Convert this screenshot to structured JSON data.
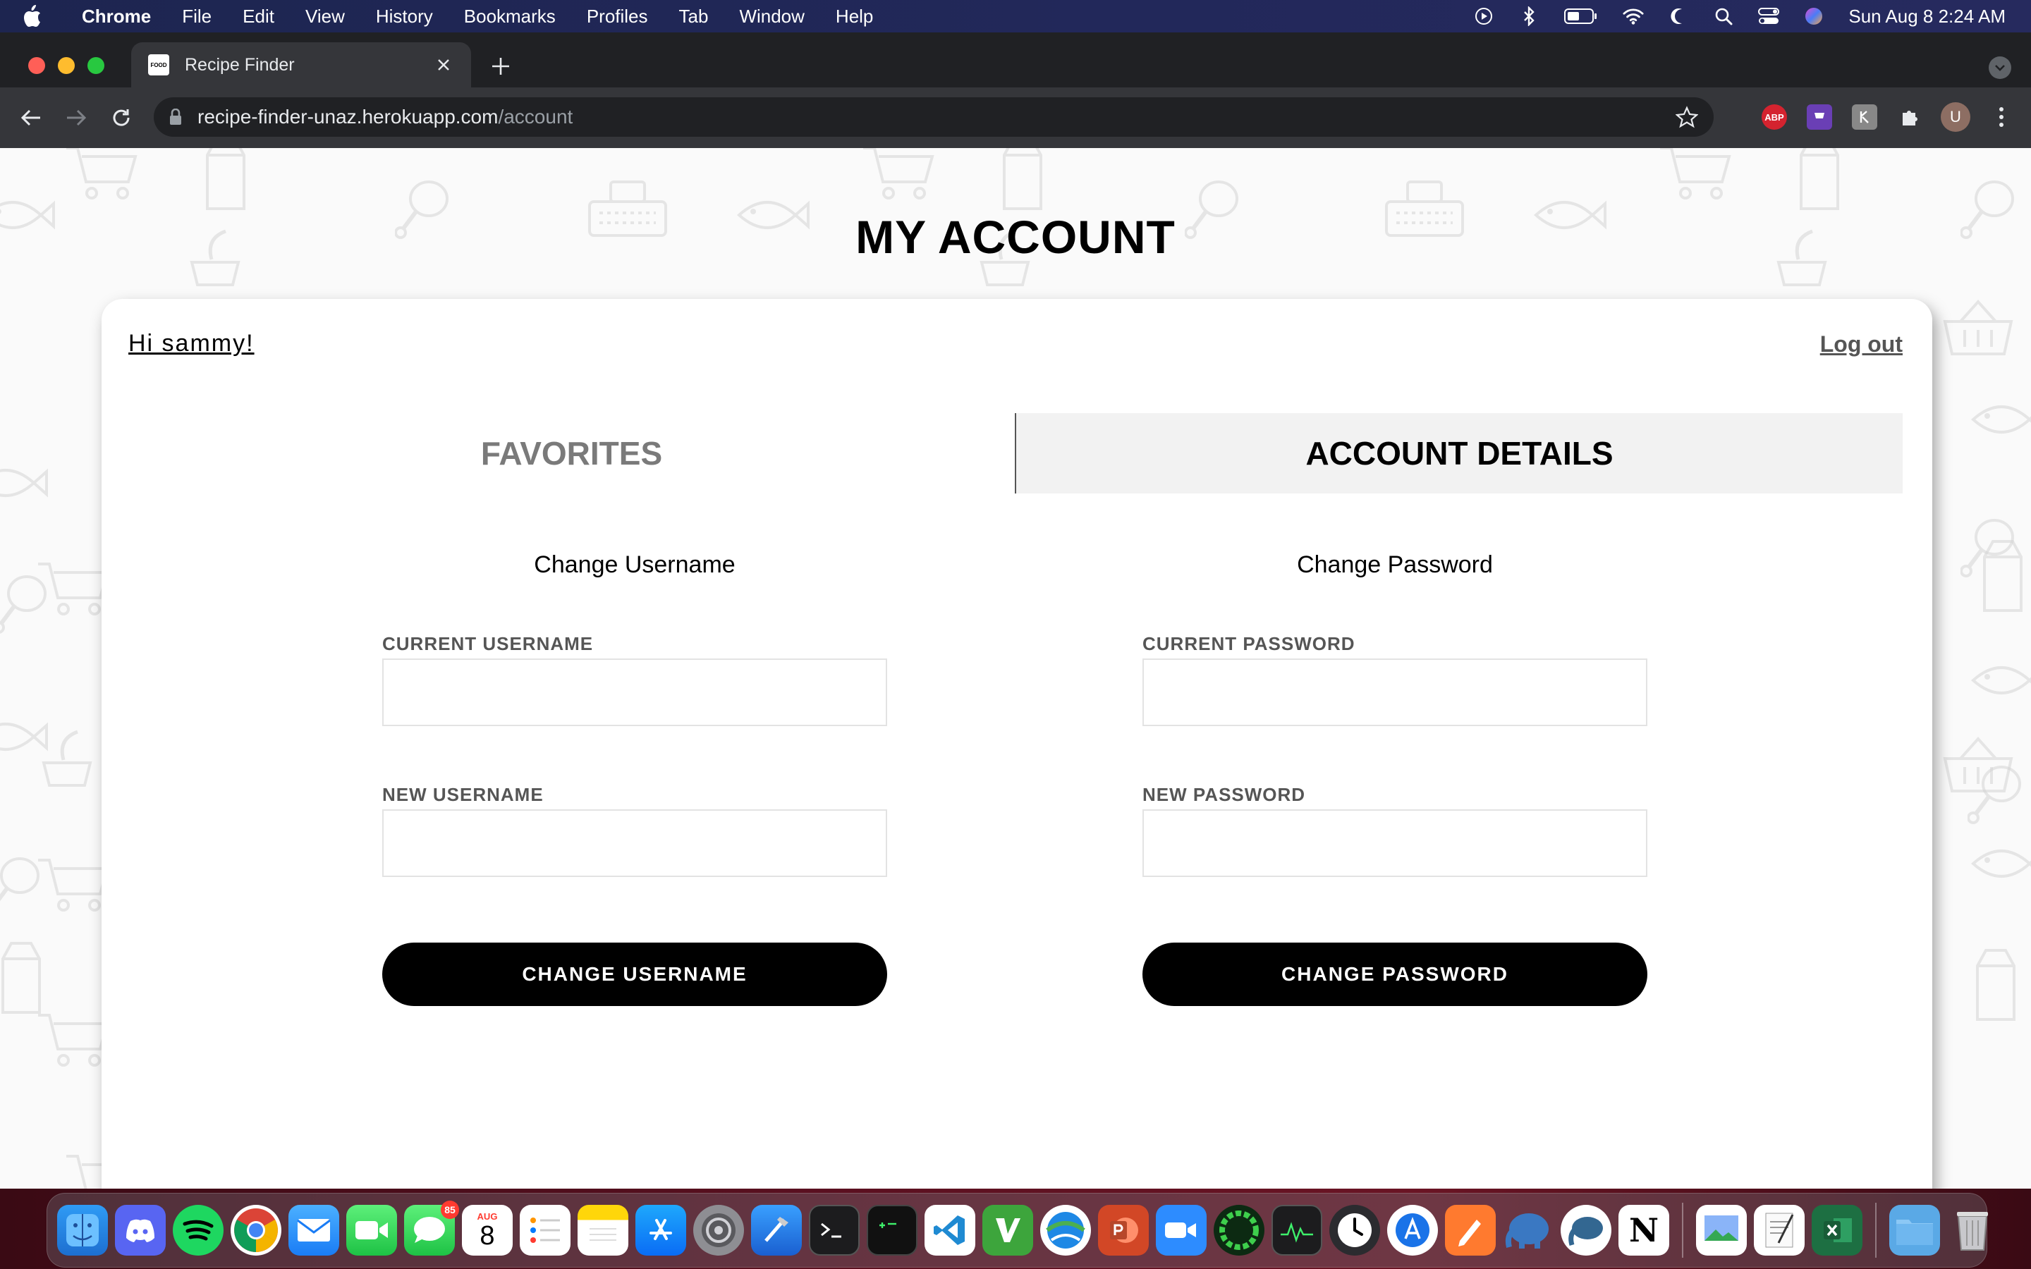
{
  "menubar": {
    "app_name": "Chrome",
    "menus": [
      "File",
      "Edit",
      "View",
      "History",
      "Bookmarks",
      "Profiles",
      "Tab",
      "Window",
      "Help"
    ],
    "clock": "Sun Aug 8  2:24 AM"
  },
  "browser": {
    "tab_title": "Recipe Finder",
    "favicon_text": "FOOD",
    "url_host": "recipe-finder-unaz.herokuapp.com",
    "url_path": "/account",
    "extensions": {
      "abp": "ABP",
      "profile": "U"
    }
  },
  "page": {
    "title": "MY ACCOUNT",
    "greeting": "Hi sammy!",
    "logout": "Log out",
    "tabs": [
      {
        "label": "FAVORITES",
        "active": false
      },
      {
        "label": "ACCOUNT DETAILS",
        "active": true
      }
    ],
    "username_section": {
      "title": "Change Username",
      "current_label": "CURRENT USERNAME",
      "current_value": "",
      "new_label": "NEW USERNAME",
      "new_value": "",
      "button": "CHANGE USERNAME"
    },
    "password_section": {
      "title": "Change Password",
      "current_label": "CURRENT PASSWORD",
      "current_value": "",
      "new_label": "NEW PASSWORD",
      "new_value": "",
      "button": "CHANGE PASSWORD"
    }
  },
  "dock": {
    "calendar_month": "AUG",
    "calendar_day": "8",
    "messages_badge": "85",
    "notion_letter": "N"
  },
  "colors": {
    "accent": "#000000",
    "tab_active_bg": "#f2f2f2",
    "inactive_tab_text": "#7a7a7a"
  }
}
